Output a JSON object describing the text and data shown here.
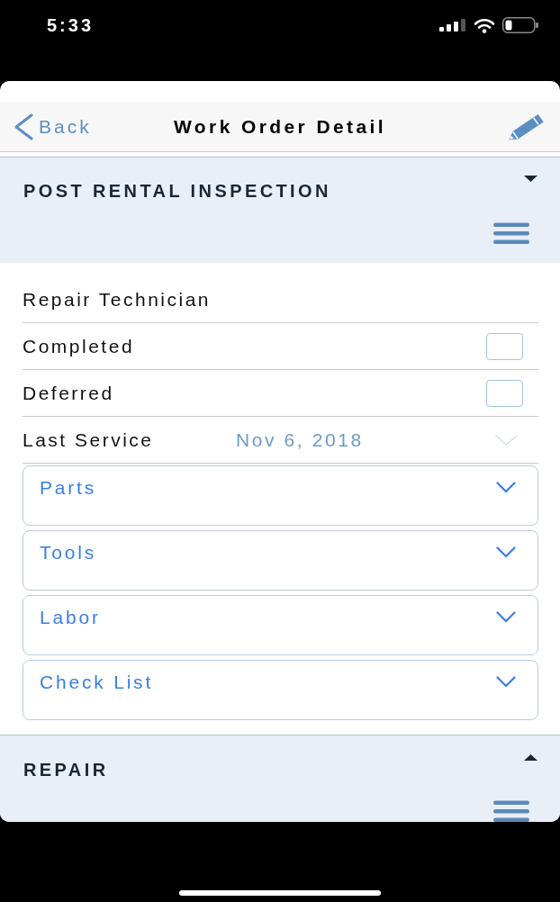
{
  "status_bar": {
    "time": "5:33"
  },
  "nav_bar": {
    "back_label": "Back",
    "title": "Work Order Detail"
  },
  "sections": [
    {
      "title": "POST RENTAL INSPECTION",
      "expanded": true,
      "fields": [
        {
          "kind": "text",
          "label": "Repair Technician"
        },
        {
          "kind": "checkbox",
          "label": "Completed",
          "checked": false
        },
        {
          "kind": "checkbox",
          "label": "Deferred",
          "checked": false
        },
        {
          "kind": "date",
          "label": "Last Service",
          "value": "Nov 6, 2018"
        }
      ],
      "panels": [
        {
          "label": "Parts",
          "expanded": false
        },
        {
          "label": "Tools",
          "expanded": false
        },
        {
          "label": "Labor",
          "expanded": false
        },
        {
          "label": "Check List",
          "expanded": false
        }
      ]
    },
    {
      "title": "REPAIR",
      "expanded": false
    }
  ]
}
